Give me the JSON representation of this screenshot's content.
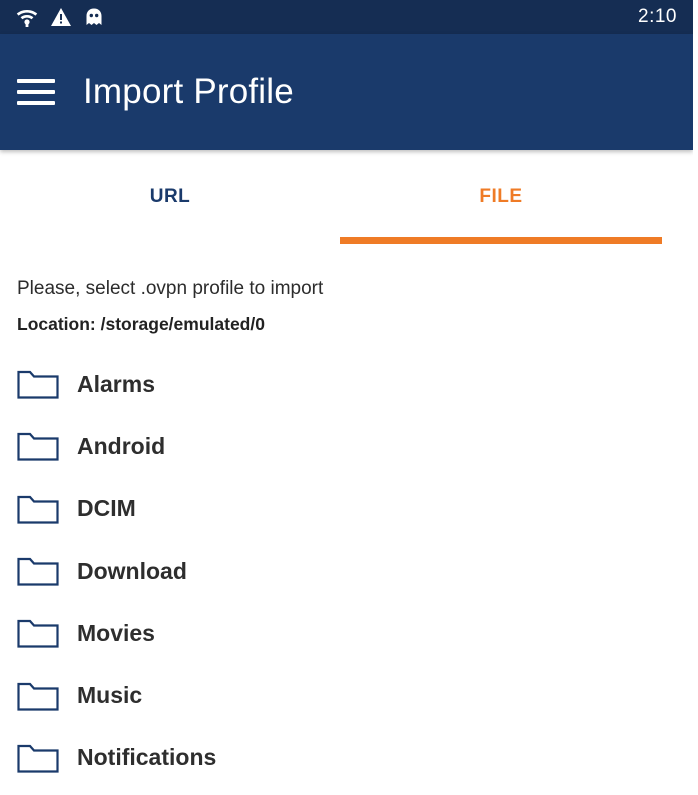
{
  "status_bar": {
    "time": "2:10",
    "icons": [
      "wifi-icon",
      "warning-icon",
      "ghost-icon"
    ]
  },
  "app_bar": {
    "menu_icon": "hamburger-menu-icon",
    "title": "Import Profile"
  },
  "tabs": [
    {
      "label": "URL",
      "selected": false
    },
    {
      "label": "FILE",
      "selected": true
    }
  ],
  "colors": {
    "status_bar": "#152d53",
    "app_bar": "#1a3a6b",
    "accent": "#ef7b26",
    "folder_icon": "#1a3a6b"
  },
  "file_browser": {
    "instruction": "Please, select .ovpn profile to import",
    "location": "Location: /storage/emulated/0",
    "folders": [
      {
        "name": "Alarms",
        "icon": "folder-icon"
      },
      {
        "name": "Android",
        "icon": "folder-icon"
      },
      {
        "name": "DCIM",
        "icon": "folder-icon"
      },
      {
        "name": "Download",
        "icon": "folder-icon"
      },
      {
        "name": "Movies",
        "icon": "folder-icon"
      },
      {
        "name": "Music",
        "icon": "folder-icon"
      },
      {
        "name": "Notifications",
        "icon": "folder-icon"
      }
    ]
  }
}
